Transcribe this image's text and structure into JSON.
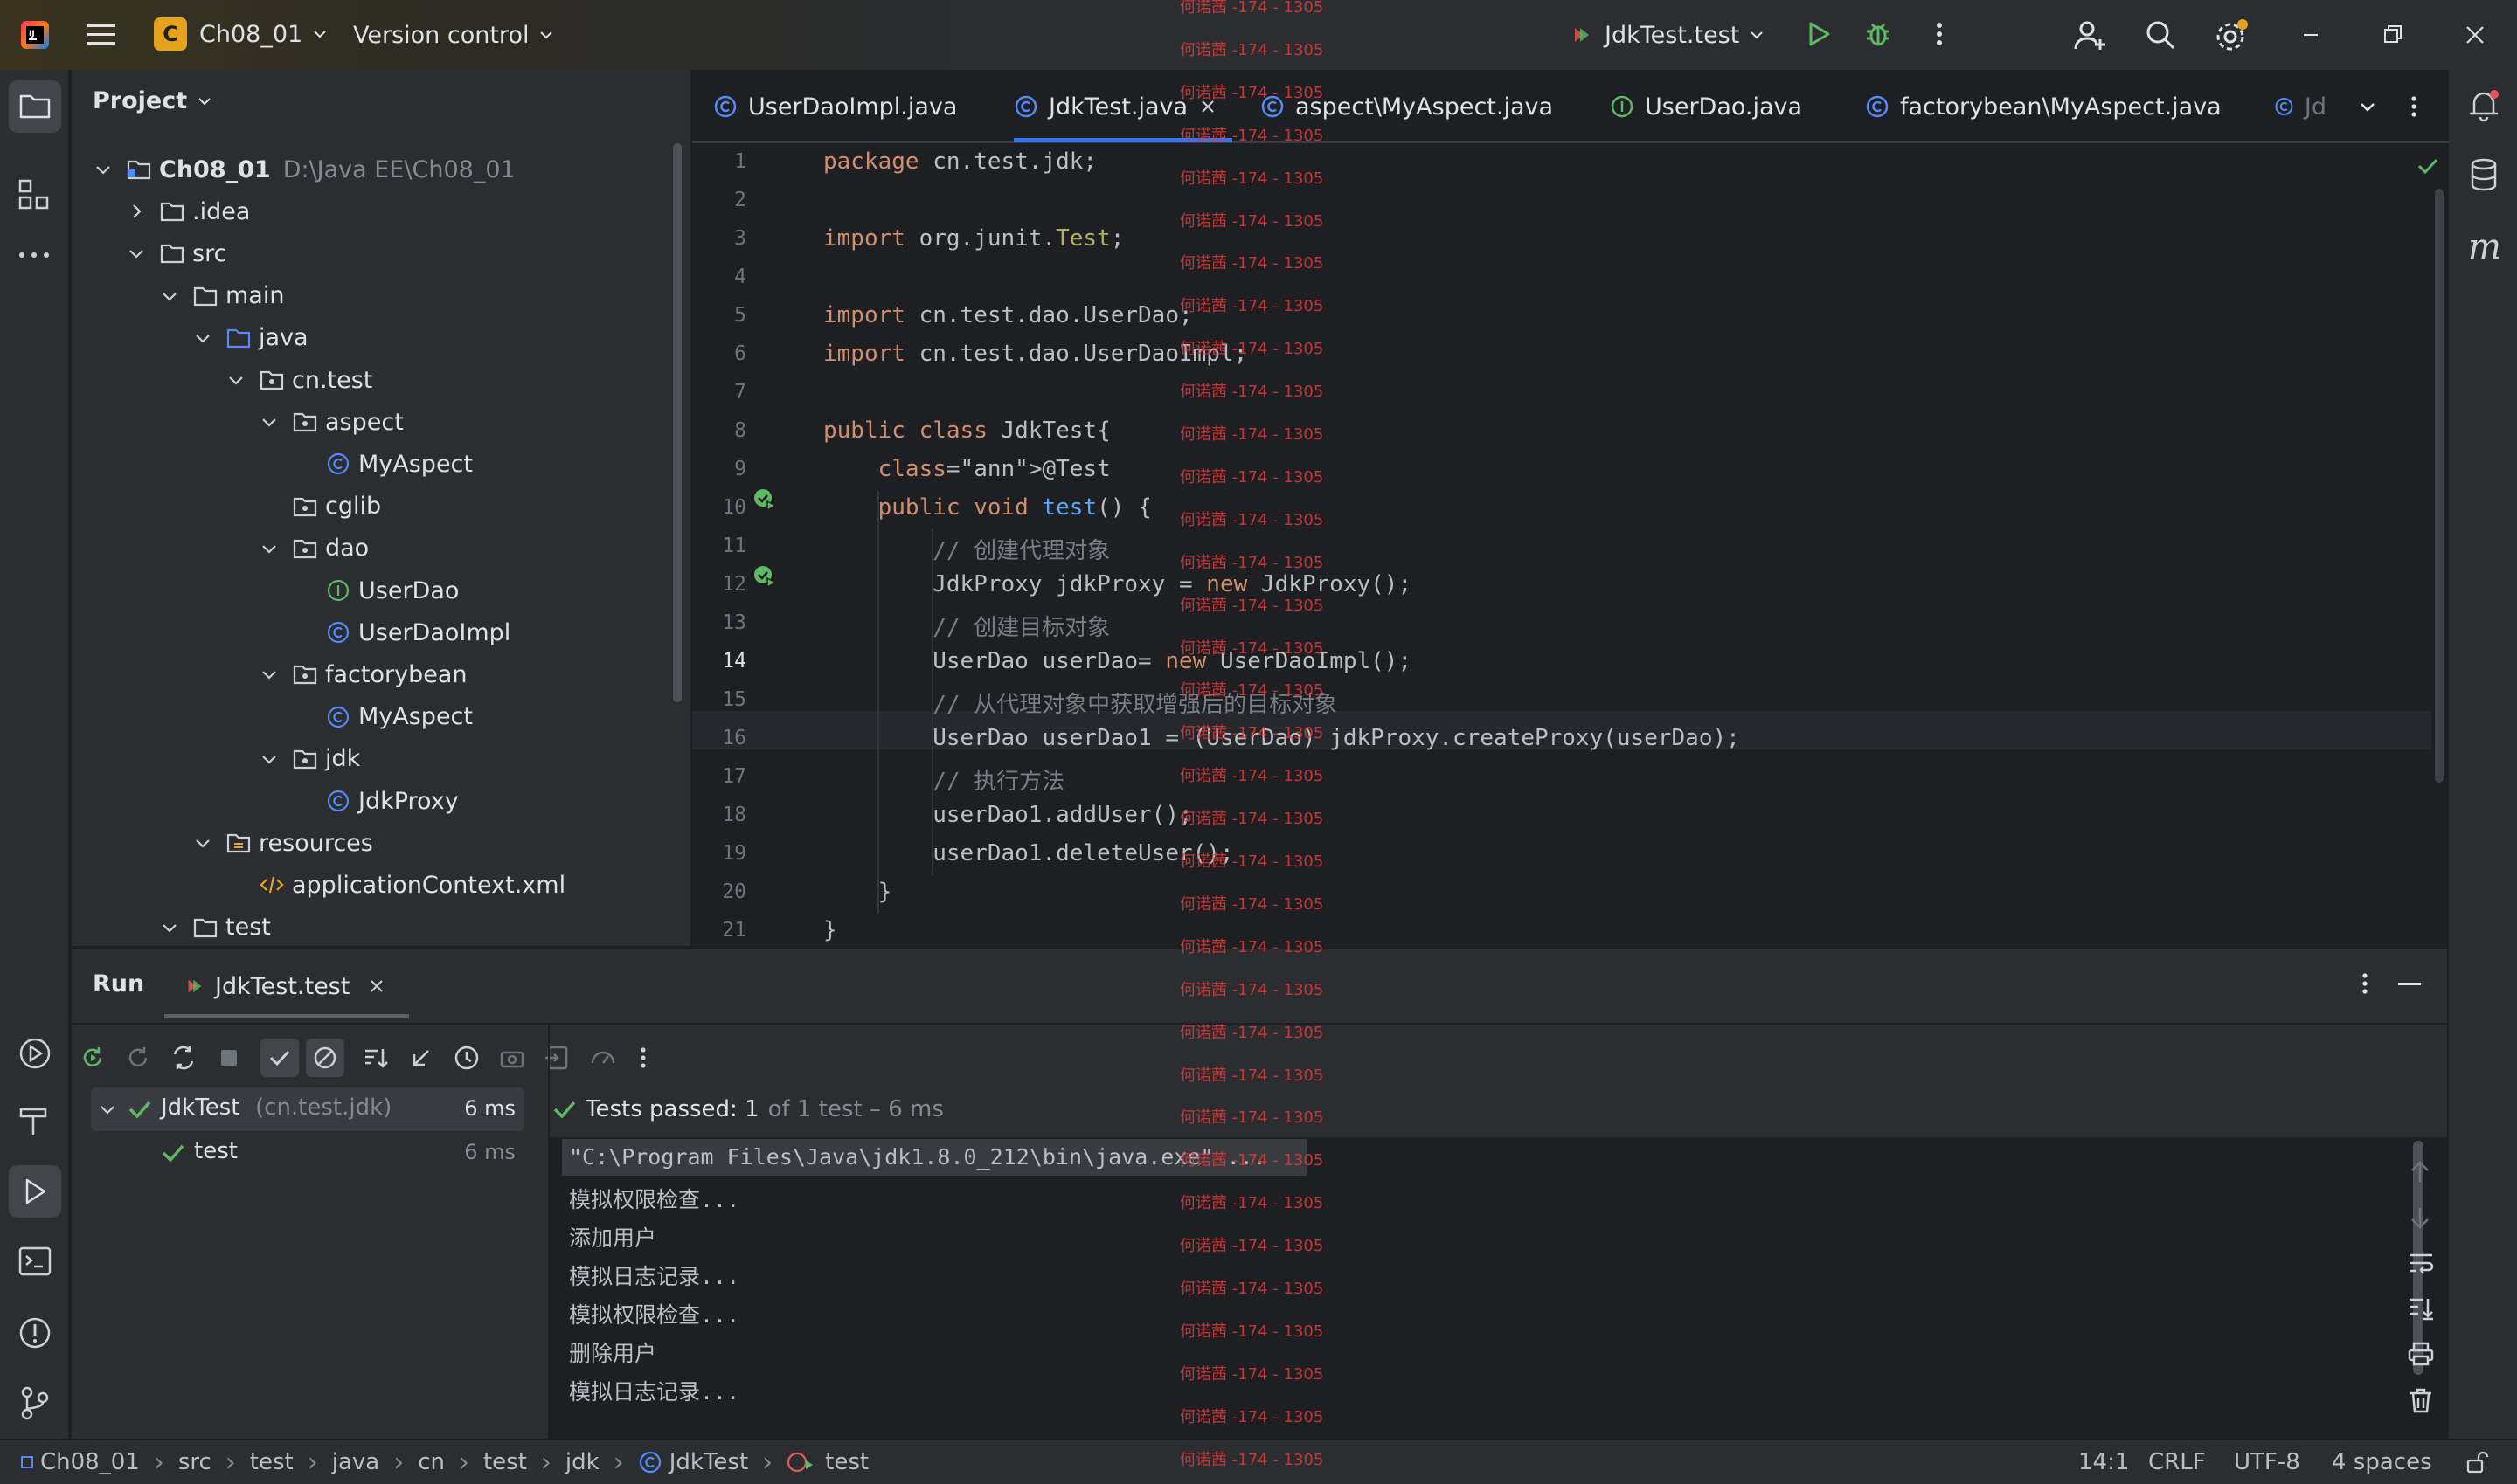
{
  "titlebar": {
    "project_badge": "C",
    "project_name": "Ch08_01",
    "version_control": "Version control",
    "run_config": "JdkTest.test"
  },
  "colors": {
    "accent": "#3574f0",
    "run_green": "#5fb865",
    "class_blue": "#548af7",
    "interface_green": "#5fb865",
    "badge_orange": "#e5a21c",
    "watermark_red": "#e03a3a"
  },
  "project_panel": {
    "title": "Project",
    "tree": [
      {
        "label": "Ch08_01",
        "path": "D:\\Java EE\\Ch08_01",
        "icon": "module-folder-icon",
        "expanded": true
      },
      {
        "label": ".idea",
        "icon": "folder-icon",
        "expanded": false
      },
      {
        "label": "src",
        "icon": "folder-icon",
        "expanded": true
      },
      {
        "label": "main",
        "icon": "folder-icon",
        "expanded": true
      },
      {
        "label": "java",
        "icon": "source-folder-icon",
        "expanded": true
      },
      {
        "label": "cn.test",
        "icon": "package-icon",
        "expanded": true
      },
      {
        "label": "aspect",
        "icon": "package-icon",
        "expanded": true
      },
      {
        "label": "MyAspect",
        "icon": "class-icon"
      },
      {
        "label": "cglib",
        "icon": "package-icon"
      },
      {
        "label": "dao",
        "icon": "package-icon",
        "expanded": true
      },
      {
        "label": "UserDao",
        "icon": "interface-icon"
      },
      {
        "label": "UserDaoImpl",
        "icon": "class-icon"
      },
      {
        "label": "factorybean",
        "icon": "package-icon",
        "expanded": true
      },
      {
        "label": "MyAspect",
        "icon": "class-icon"
      },
      {
        "label": "jdk",
        "icon": "package-icon",
        "expanded": true
      },
      {
        "label": "JdkProxy",
        "icon": "class-icon"
      },
      {
        "label": "resources",
        "icon": "resources-folder-icon",
        "expanded": true
      },
      {
        "label": "applicationContext.xml",
        "icon": "xml-file-icon"
      },
      {
        "label": "test",
        "icon": "folder-icon",
        "expanded": true
      }
    ]
  },
  "editor": {
    "tabs": [
      {
        "label": "UserDaoImpl.java",
        "icon": "class-icon",
        "active": false
      },
      {
        "label": "JdkTest.java",
        "icon": "class-icon",
        "active": true
      },
      {
        "label": "aspect\\MyAspect.java",
        "icon": "class-icon",
        "active": false
      },
      {
        "label": "UserDao.java",
        "icon": "interface-icon",
        "active": false
      },
      {
        "label": "factorybean\\MyAspect.java",
        "icon": "class-icon",
        "active": false
      },
      {
        "label": "Jd",
        "icon": "class-icon",
        "active": false
      }
    ],
    "current_line": 14,
    "lines": [
      "package cn.test.jdk;",
      "",
      "import org.junit.Test;",
      "",
      "import cn.test.dao.UserDao;",
      "import cn.test.dao.UserDaoImpl;",
      "",
      "public class JdkTest{",
      "    @Test",
      "    public void test() {",
      "        // 创建代理对象",
      "        JdkProxy jdkProxy = new JdkProxy();",
      "        // 创建目标对象",
      "        UserDao userDao= new UserDaoImpl();",
      "        // 从代理对象中获取增强后的目标对象",
      "        UserDao userDao1 = (UserDao) jdkProxy.createProxy(userDao);",
      "        // 执行方法",
      "        userDao1.addUser();",
      "        userDao1.deleteUser();",
      "    }",
      "}"
    ]
  },
  "run_panel": {
    "title": "Run",
    "tab_label": "JdkTest.test",
    "test_tree": [
      {
        "name": "JdkTest",
        "detail": "(cn.test.jdk)",
        "time": "6 ms"
      },
      {
        "name": "test",
        "time": "6 ms"
      }
    ],
    "summary_bold": "Tests passed: 1",
    "summary_rest": "of 1 test – 6 ms",
    "console": [
      "\"C:\\Program Files\\Java\\jdk1.8.0_212\\bin\\java.exe\" ...",
      "模拟权限检查...",
      "添加用户",
      "模拟日志记录...",
      "模拟权限检查...",
      "删除用户",
      "模拟日志记录..."
    ]
  },
  "statusbar": {
    "breadcrumbs": [
      "Ch08_01",
      "src",
      "test",
      "java",
      "cn",
      "test",
      "jdk",
      "JdkTest",
      "test"
    ],
    "position": "14:1",
    "line_sep": "CRLF",
    "encoding": "UTF-8",
    "indent": "4 spaces"
  },
  "watermark": "何诺茜 -174 - 1305"
}
